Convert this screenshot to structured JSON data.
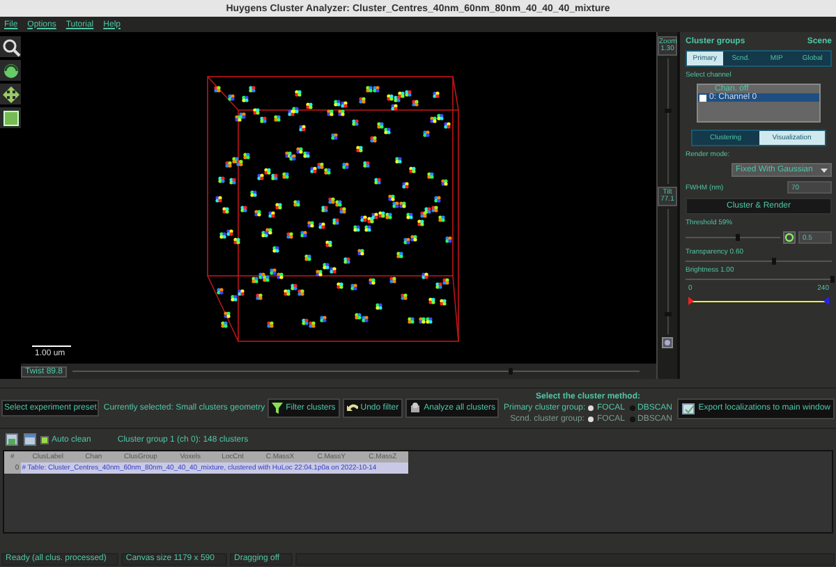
{
  "window": {
    "title": "Huygens Cluster Analyzer: Cluster_Centres_40nm_60nm_80nm_40_40_40_mixture"
  },
  "menu": [
    "File",
    "Options",
    "Tutorial",
    "Help"
  ],
  "viewport": {
    "scale_label": "1.00 um",
    "twist": {
      "label": "Twist 89.8",
      "level": 0.77
    },
    "zoom": {
      "label": "Zoom\n1.30",
      "level": 0.6
    },
    "tilt": {
      "label": "Tilt\n77.1",
      "level": 0.18
    }
  },
  "panel": {
    "title": "Cluster groups",
    "scene_label": "Scene",
    "group_tabs": [
      {
        "label": "Primary",
        "selected": true
      },
      {
        "label": "Scnd.",
        "selected": false
      },
      {
        "label": "MIP",
        "selected": false
      },
      {
        "label": "Global",
        "selected": false
      }
    ],
    "channel_label": "Select channel",
    "channel_header": "Chan. off",
    "channels": [
      {
        "label": "0: Channel 0",
        "checked": false,
        "selected": true
      }
    ],
    "mode_tabs": [
      {
        "label": "Clustering",
        "selected": false
      },
      {
        "label": "Visualization",
        "selected": true
      }
    ],
    "render_mode_label": "Render mode:",
    "render_mode": "Fixed With Gaussian",
    "fwhm_label": "FWHM (nm)",
    "fwhm": "70",
    "cluster_button": "Cluster & Render",
    "sliders": [
      {
        "label": "Threshold 59%",
        "level": 0.55,
        "value": "0.5"
      },
      {
        "label": "Transparency 0.60",
        "level": 0.6
      },
      {
        "label": "Brightness 1.00",
        "level": 1.0
      }
    ],
    "range": {
      "min": "0",
      "max": "240",
      "level": 1
    }
  },
  "controls": {
    "preset_button": "Select experiment preset",
    "current": "Currently selected: Small clusters geometry",
    "buttons": [
      "Filter clusters",
      "Undo filter",
      "Analyze all clusters"
    ],
    "method_title": "Select the cluster method:",
    "methods": [
      {
        "label": "Primary cluster group:",
        "disabled": false,
        "options": [
          {
            "label": "FOCAL",
            "selected": true
          },
          {
            "label": "DBSCAN",
            "selected": false
          }
        ]
      },
      {
        "label": "Scnd. cluster group:",
        "disabled": true,
        "options": [
          {
            "label": "FOCAL",
            "selected": true
          },
          {
            "label": "DBSCAN",
            "selected": false
          }
        ]
      }
    ],
    "export_button": "Export localizations to main window",
    "auto_clean": {
      "label": "Auto clean",
      "checked": true
    },
    "summary": "Cluster group 1 (ch 0): 148 clusters"
  },
  "table": {
    "columns": [
      "#",
      "ClusLabel",
      "Chan",
      "ClusGroup",
      "Voxels",
      "LocCnt",
      "C.MassX",
      "C.MassY",
      "C.MassZ"
    ],
    "rows": [
      {
        "index": "0",
        "text": "# Table: Cluster_Centres_40nm_60nm_80nm_40_40_40_mixture, clustered with HuLoc 22:04.1p0a on 2022-10-14"
      }
    ]
  },
  "status_bar": [
    "Ready (all clus. processed)",
    "Canvas size 1179 x 590",
    "Dragging off"
  ]
}
